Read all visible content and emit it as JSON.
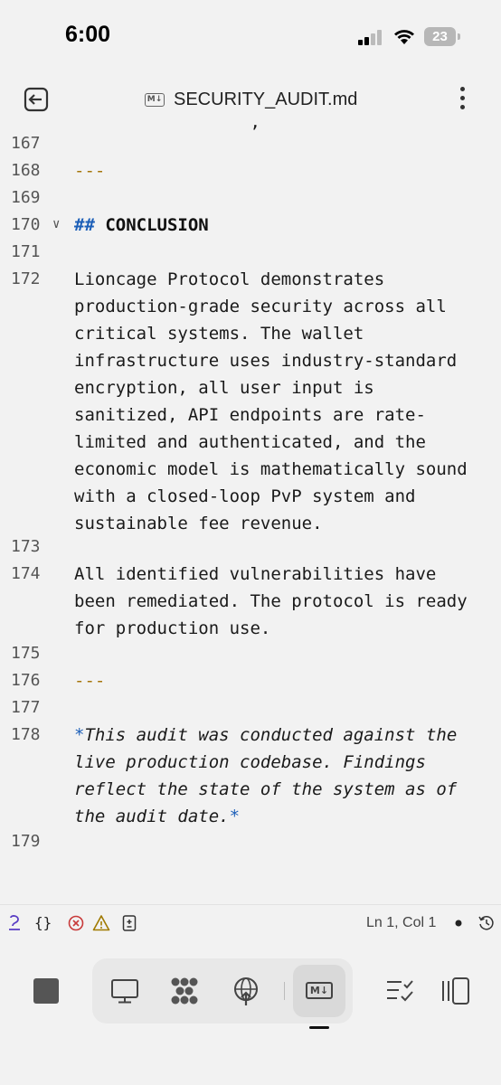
{
  "status_bar": {
    "time": "6:00",
    "battery": "23",
    "icons": [
      "signal-icon",
      "wifi-icon",
      "battery-icon"
    ]
  },
  "title_bar": {
    "file_badge": "M↓",
    "file_name": "SECURITY_AUDIT.md",
    "icons": [
      "back-icon",
      "more-icon"
    ]
  },
  "editor": {
    "partial_top_text": "",
    "lines": [
      {
        "n": "167",
        "text": ""
      },
      {
        "n": "168",
        "text": "---"
      },
      {
        "n": "169",
        "text": ""
      },
      {
        "n": "170",
        "hash": "##",
        "text": "CONCLUSION"
      },
      {
        "n": "171",
        "text": ""
      },
      {
        "n": "172",
        "wrapped": [
          "Lioncage Protocol demonstrates",
          "production-grade security across all",
          "critical systems. The wallet",
          "infrastructure uses industry-standard",
          "encryption, all user input is",
          "sanitized, API endpoints are rate-",
          "limited and authenticated, and the",
          "economic model is mathematically sound",
          "with a closed-loop PvP system and",
          "sustainable fee revenue."
        ]
      },
      {
        "n": "173",
        "text": ""
      },
      {
        "n": "174",
        "wrapped": [
          "All identified vulnerabilities have",
          "been remediated. The protocol is ready",
          "for production use."
        ]
      },
      {
        "n": "175",
        "text": ""
      },
      {
        "n": "176",
        "text": "---"
      },
      {
        "n": "177",
        "text": ""
      },
      {
        "n": "178",
        "italic": [
          "This audit was conducted against the",
          "live production codebase. Findings",
          "reflect the state of the system as of",
          "the audit date."
        ],
        "star": "*"
      },
      {
        "n": "179",
        "text": ""
      }
    ]
  },
  "editor_status": {
    "braces": "{}",
    "cursor_position": "Ln 1, Col 1",
    "icons": [
      "copilot-icon",
      "error-icon",
      "warning-icon",
      "file-diff-icon",
      "dot-icon",
      "history-icon"
    ]
  },
  "bottom_bar": {
    "md_badge": "M↓",
    "icons": [
      "stop-icon",
      "desktop-icon",
      "extensions-icon",
      "deploy-icon",
      "markdown-preview-icon",
      "checklist-icon",
      "panel-icon"
    ]
  }
}
